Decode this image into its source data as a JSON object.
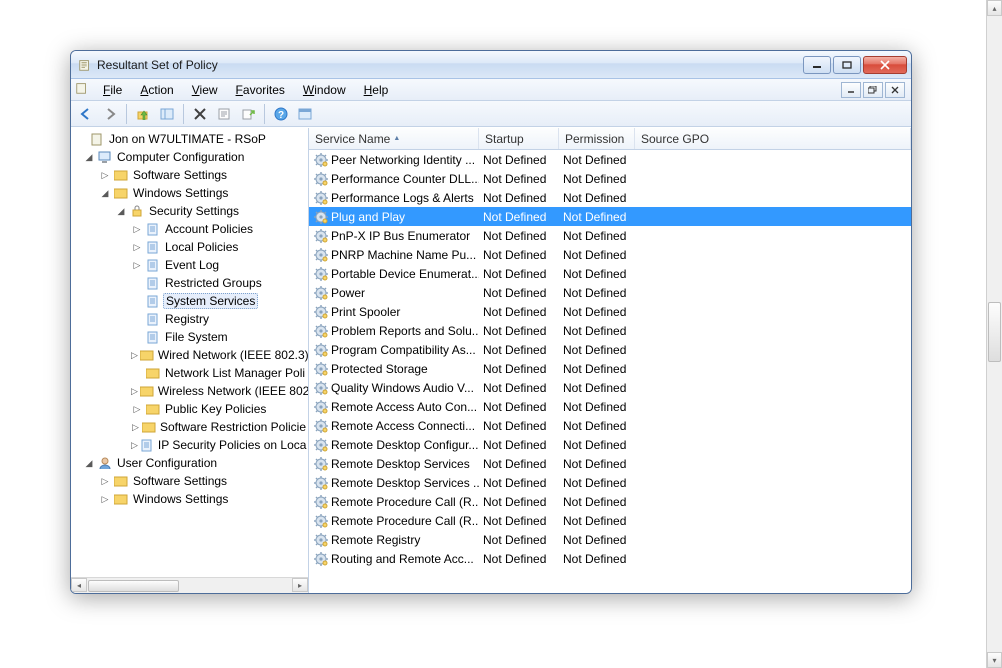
{
  "window": {
    "title": "Resultant Set of Policy"
  },
  "menu": [
    "File",
    "Action",
    "View",
    "Favorites",
    "Window",
    "Help"
  ],
  "tree": {
    "root": "Jon on W7ULTIMATE - RSoP",
    "comp_config": "Computer Configuration",
    "comp_software": "Software Settings",
    "comp_windows": "Windows Settings",
    "security": "Security Settings",
    "sec_children": [
      "Account Policies",
      "Local Policies",
      "Event Log",
      "Restricted Groups",
      "System Services",
      "Registry",
      "File System",
      "Wired Network (IEEE 802.3)",
      "Network List Manager Poli",
      "Wireless Network (IEEE 802",
      "Public Key Policies",
      "Software Restriction Policie",
      "IP Security Policies on Loca"
    ],
    "user_config": "User Configuration",
    "user_software": "Software Settings",
    "user_windows": "Windows Settings",
    "selected": "System Services"
  },
  "columns": {
    "name": "Service Name",
    "startup": "Startup",
    "perm": "Permission",
    "gpo": "Source GPO"
  },
  "nd": "Not Defined",
  "services": [
    "Peer Networking Identity ...",
    "Performance Counter DLL...",
    "Performance Logs & Alerts",
    "Plug and Play",
    "PnP-X IP Bus Enumerator",
    "PNRP Machine Name Pu...",
    "Portable Device Enumerat...",
    "Power",
    "Print Spooler",
    "Problem Reports and Solu...",
    "Program Compatibility As...",
    "Protected Storage",
    "Quality Windows Audio V...",
    "Remote Access Auto Con...",
    "Remote Access Connecti...",
    "Remote Desktop Configur...",
    "Remote Desktop Services",
    "Remote Desktop Services ...",
    "Remote Procedure Call (R...",
    "Remote Procedure Call (R...",
    "Remote Registry",
    "Routing and Remote Acc..."
  ],
  "selected_service_index": 3
}
